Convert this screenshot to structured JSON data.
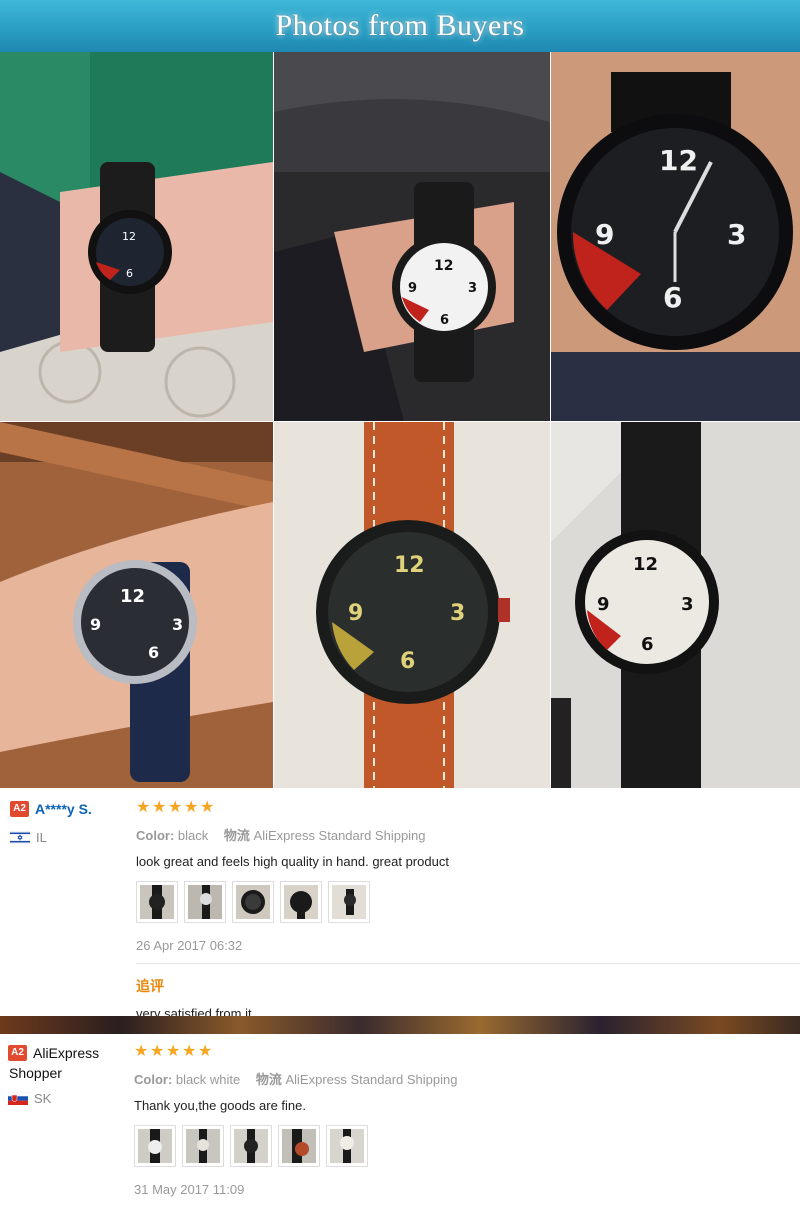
{
  "banner": {
    "title": "Photos from Buyers"
  },
  "photos": [
    {
      "label": "wrist-photo-1"
    },
    {
      "label": "wrist-photo-2"
    },
    {
      "label": "watch-closeup-3"
    },
    {
      "label": "wrist-photo-4"
    },
    {
      "label": "watch-brown-strap-5"
    },
    {
      "label": "watch-white-dial-6"
    }
  ],
  "reviews": [
    {
      "badge": "A2",
      "author": "A****y S.",
      "country_code": "IL",
      "stars": 5,
      "color_label": "Color:",
      "color_value": "black",
      "shipping_label": "物流",
      "shipping_value": "AliExpress Standard Shipping",
      "text": "look great and feels high quality in hand. great product",
      "thumb_count": 5,
      "date": "26 Apr 2017 06:32",
      "followup_label": "追评",
      "followup_text": "very satisfied from it"
    },
    {
      "badge": "A2",
      "author_line1": "AliExpress",
      "author_line2": "Shopper",
      "country_code": "SK",
      "stars": 5,
      "color_label": "Color:",
      "color_value": "black white",
      "shipping_label": "物流",
      "shipping_value": "AliExpress Standard Shipping",
      "text": "Thank you,the goods are fine.",
      "thumb_count": 5,
      "date": "31 May 2017 11:09"
    }
  ],
  "colors": {
    "star": "#f5a623",
    "author_link": "#0d63b4",
    "followup": "#e8870c",
    "banner": "#2a9fc4"
  }
}
